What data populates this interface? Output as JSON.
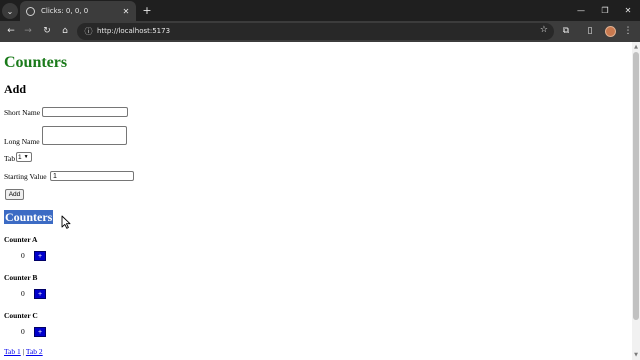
{
  "browser": {
    "tab_title": "Clicks: 0, 0, 0",
    "url": "http://localhost:5173"
  },
  "page": {
    "title": "Counters",
    "add_section": {
      "heading": "Add",
      "short_name_label": "Short Name",
      "short_name_value": "",
      "long_name_label": "Long Name",
      "long_name_value": "",
      "tab_label": "Tab",
      "tab_selected": "1",
      "starting_value_label": "Starting Value",
      "starting_value": "1",
      "add_button": "Add"
    },
    "counters_heading": "Counters",
    "counters": [
      {
        "name": "Counter A",
        "value": "0",
        "button": "+"
      },
      {
        "name": "Counter B",
        "value": "0",
        "button": "+"
      },
      {
        "name": "Counter C",
        "value": "0",
        "button": "+"
      }
    ],
    "tabs": [
      {
        "label": "Tab 1"
      },
      {
        "label": "Tab 2"
      }
    ],
    "tab_separator": "|"
  }
}
